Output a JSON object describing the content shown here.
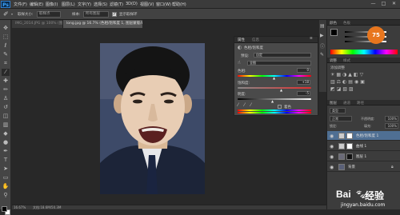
{
  "app": {
    "logo": "Ps"
  },
  "menu": [
    "文件(F)",
    "编辑(E)",
    "图像(I)",
    "图层(L)",
    "文字(Y)",
    "选择(S)",
    "滤镜(T)",
    "3D(D)",
    "视图(V)",
    "窗口(W)",
    "帮助(H)"
  ],
  "window_controls": [
    "—",
    "□",
    "✕"
  ],
  "options": {
    "size_label": "取样大小:",
    "size_value": "取样点",
    "sample_label": "样本:",
    "sample_value": "所有图层",
    "show_ring_label": "显示取样环"
  },
  "doc_tabs": [
    {
      "label": "IMG_2014.JPG @ 100% (图层 1, RGB/8) ×"
    },
    {
      "label": "long.jpg @ 16.7% (色相/饱和度 1, 图层蒙版/8) ×"
    }
  ],
  "status": {
    "zoom": "16.67%",
    "doc": "文档:18.6M/50.3M"
  },
  "adjustment_panel": {
    "tab1": "属性",
    "tab2": "信息",
    "title": "色相/饱和度",
    "preset_label": "预设:",
    "preset_value": "自定",
    "channel_value": "全图",
    "hue_label": "色相:",
    "hue_value": "0",
    "sat_label": "饱和度:",
    "sat_value": "+18",
    "light_label": "明度:",
    "light_value": "-5",
    "colorize_label": "着色"
  },
  "right_panels": {
    "color_tab": "颜色",
    "swatch_tab": "色板",
    "adjust_tab": "调整",
    "styles_tab": "样式",
    "add_adjust_label": "添加调整",
    "layers_tab": "图层",
    "channels_tab": "通道",
    "paths_tab": "路径",
    "kind_label": "类型",
    "blend_mode": "正常",
    "opacity_label": "不透明度:",
    "opacity_value": "100%",
    "lock_label": "锁定:",
    "fill_label": "填充:",
    "fill_value": "100%",
    "badge": "75"
  },
  "layers": [
    {
      "name": "色相/饱和度 1"
    },
    {
      "name": "曲线 1"
    },
    {
      "name": "图层 1"
    },
    {
      "name": "背景"
    }
  ],
  "watermark": {
    "brand": "Bai",
    "brand2": "经验",
    "url": "jingyan.baidu.com"
  },
  "colors": {
    "bg": "#282828",
    "panel": "#4a4a4a",
    "accent": "#2f7fd0",
    "badge": "#e8761e"
  }
}
